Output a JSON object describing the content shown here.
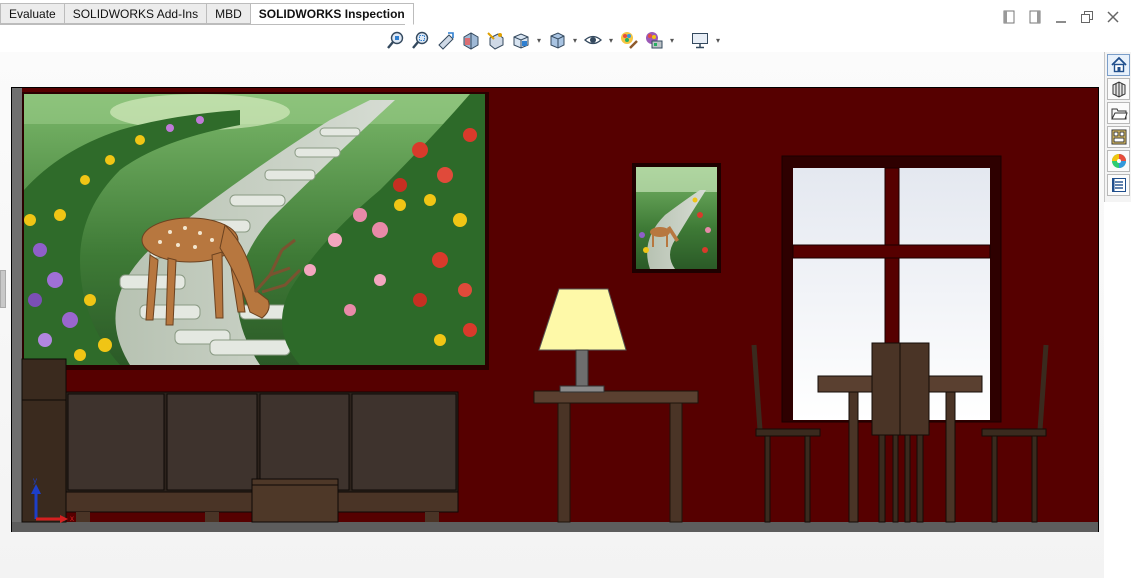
{
  "tabs": [
    {
      "label": "Evaluate",
      "active": false
    },
    {
      "label": "SOLIDWORKS Add-Ins",
      "active": false
    },
    {
      "label": "MBD",
      "active": false
    },
    {
      "label": "SOLIDWORKS Inspection",
      "active": true
    }
  ],
  "window_controls": [
    "restore-left-icon",
    "restore-right-icon",
    "minimize-icon",
    "maximize-icon",
    "close-icon"
  ],
  "view_toolbar": [
    "zoom-to-fit-icon",
    "zoom-to-area-icon",
    "previous-view-icon",
    "section-view-icon",
    "dynamic-annotation-views-icon",
    "view-orientation-icon",
    "display-style-icon",
    "hide-show-items-icon",
    "edit-appearance-icon",
    "apply-scene-icon",
    "view-settings-icon"
  ],
  "task_pane": [
    "solidworks-resources-icon",
    "design-library-icon",
    "file-explorer-icon",
    "view-palette-icon",
    "appearances-scenes-icon",
    "custom-properties-icon"
  ],
  "triad": {
    "x_label": "x",
    "y_label": "y"
  },
  "colors": {
    "wall": "#560000",
    "wood_dark": "#3a2a1e",
    "wood": "#5a4030",
    "cushion": "#3e332d",
    "lamp_shade": "#fef9a8",
    "sky": "#e6eaf2"
  }
}
